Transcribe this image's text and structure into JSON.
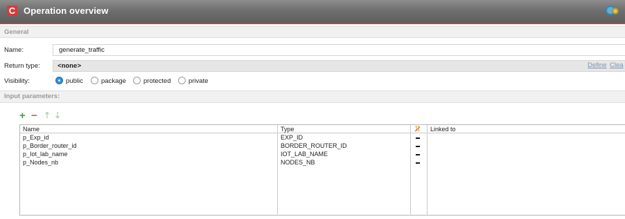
{
  "window": {
    "title": "Operation overview",
    "app_icon_letter": "C"
  },
  "sections": {
    "general": "General",
    "input_parameters": "Input parameters:"
  },
  "form": {
    "name_label": "Name:",
    "name_value": "generate_traffic",
    "return_type_label": "Return type:",
    "return_type_value": "<none>",
    "define_link": "Define",
    "clear_link": "Clea",
    "visibility_label": "Visibility:",
    "visibility_options": [
      "public",
      "package",
      "protected",
      "private"
    ],
    "visibility_selected": "public"
  },
  "toolbar": {
    "add_label": "+",
    "remove_label": "−",
    "up_label": "⇡",
    "down_label": "⇣"
  },
  "table": {
    "columns": [
      "Name",
      "Type",
      "",
      "Linked to"
    ],
    "rows": [
      {
        "name": "p_Exp_id",
        "type": "EXP_ID",
        "flag": "-",
        "linked": ""
      },
      {
        "name": "p_Border_router_id",
        "type": "BORDER_ROUTER_ID",
        "flag": "-",
        "linked": ""
      },
      {
        "name": "p_Iot_lab_name",
        "type": "IOT_LAB_NAME",
        "flag": "-",
        "linked": ""
      },
      {
        "name": "p_Nodes_nb",
        "type": "NODES_NB",
        "flag": "-",
        "linked": ""
      }
    ]
  },
  "colors": {
    "accent_red": "#cf3b3b",
    "radio_selected": "#2a8fe0",
    "add_green": "#3aa63a",
    "remove_red": "#e05050"
  }
}
